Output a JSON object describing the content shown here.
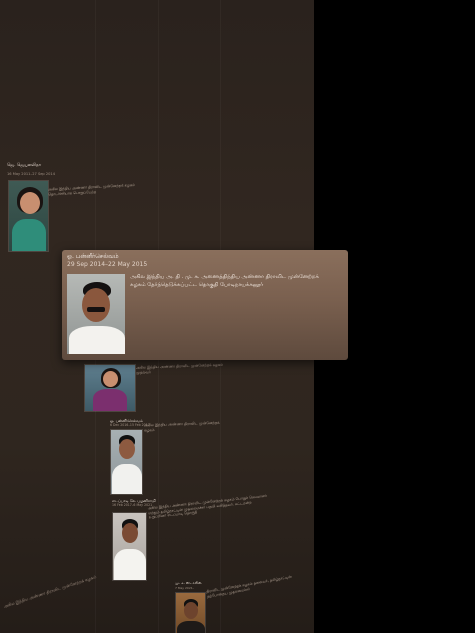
{
  "timeline": {
    "entries": [
      {
        "name": "ஜெ. ஜெயலலிதா",
        "date": "16 May 2011–27 Sep 2014",
        "desc": "அகில இந்திய அண்ணா திராவிட முன்னேற்றக் கழகம் தொடர்ச்சியாக பொறுப்பேற்ற"
      },
      {
        "name": "ஜெ. ஜெயலலிதா",
        "date": "23 May 2015–5 Dec 2016",
        "desc": "அகில இந்திய அண்ணா திராவிட முன்னேற்றக் கழகம் முதல்வர்"
      },
      {
        "name": "ஓ. பன்னீர்செல்வம்",
        "date": "6 Dec 2016–15 Feb 2017",
        "desc": "அகில இந்திய அண்ணா திராவிட முன்னேற்றக் கழகம்"
      },
      {
        "name": "எடப்பாடி கே. பழனிசாமி",
        "date": "16 Feb 2017–6 May 2021",
        "desc": "அகில இந்திய அண்ணா திராவிட முன்னேற்றக் கழகம் பொதுச் செயலாளர் மற்றும் தமிழ்நாட்டின் முதலமைச்சர் பதவி வகித்தவர். சட்டமன்ற உறுப்பினர் எடப்பாடி தொகுதி"
      },
      {
        "name": "மு. க. ஸ்டாலின்",
        "date": "7 May 2021–",
        "desc": "திராவிட முன்னேற்றக் கழகம் தலைவர், தமிழ்நாட்டின் தற்போதைய முதலமைச்சர்"
      }
    ],
    "side_label": "அகில இந்திய அண்ணா திராவிட முன்னேற்றக் கழகம்"
  },
  "card": {
    "name": "ஓ. பன்னீர்செல்வம்",
    "date": "29 Sep 2014–22 May 2015",
    "desc": "அகில இந்திய அ. தி . மு. க. அணைத்திந்திய அண்ணா திராவிட முன்னேற்றக் கழகம் தேர்ந்தெடுக்கப்பட்ட தொகுதி போடிநாயக்கனூர்"
  },
  "colors": {
    "wall": "#2f261f",
    "card": "#7a604f",
    "background": "#000000"
  }
}
